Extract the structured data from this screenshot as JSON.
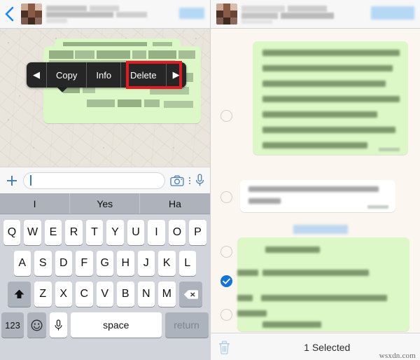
{
  "left_panel": {
    "nav": {
      "back_icon": "back-chevron-icon",
      "avatar_icon": "contact-avatar",
      "contact_name_redacted": "",
      "call_action_redacted": ""
    },
    "context_menu": {
      "prev_label": "◀",
      "items": [
        "Copy",
        "Info",
        "Delete"
      ],
      "next_label": "▶",
      "highlighted_item": "Delete",
      "highlight_color": "#e01b24",
      "background_color": "#262626"
    },
    "input_bar": {
      "attach_label": "+",
      "placeholder": "",
      "value": "",
      "camera_icon": "camera-icon",
      "more_icon": "more-vertical-icon",
      "mic_icon": "microphone-icon"
    },
    "keyboard": {
      "predictions": [
        "I",
        "Yes",
        "Ha"
      ],
      "row1": [
        "Q",
        "W",
        "E",
        "R",
        "T",
        "Y",
        "U",
        "I",
        "O",
        "P"
      ],
      "row2": [
        "A",
        "S",
        "D",
        "F",
        "G",
        "H",
        "J",
        "K",
        "L"
      ],
      "row3": [
        "Z",
        "X",
        "C",
        "V",
        "B",
        "N",
        "M"
      ],
      "shift_icon": "shift-arrow-icon",
      "backspace_icon": "backspace-icon",
      "numbers_label": "123",
      "emoji_icon": "smiley-icon",
      "dictation_icon": "microphone-icon",
      "space_label": "space",
      "return_label": "return"
    }
  },
  "right_panel": {
    "nav": {
      "avatar_icon": "contact-avatar",
      "contact_name_redacted": "",
      "call_action_redacted": ""
    },
    "messages": [
      {
        "id": "msg-1",
        "direction": "outgoing",
        "selected": false,
        "text_redacted": "Hi, all done and dusted here - sat in train back, now so should be in office at 3. Discovery had a guy filming and put on a GoPro so should have some footage to go with article too!",
        "timestamp_redacted": ""
      },
      {
        "id": "msg-2",
        "direction": "incoming",
        "selected": false,
        "text_redacted": "Sounds good! Can't wait to see",
        "timestamp_redacted": ""
      },
      {
        "id": "msg-3",
        "direction": "outgoing",
        "selected": true,
        "text_redacted": "",
        "timestamp_redacted": ""
      },
      {
        "id": "msg-4",
        "direction": "outgoing",
        "selected": false,
        "text_redacted": "",
        "timestamp_redacted": ""
      }
    ],
    "bottom_bar": {
      "trash_icon": "trash-icon",
      "selection_label": "1 Selected",
      "trash_highlight_color": "#e01b24"
    }
  },
  "watermark": {
    "text": "wsxdn.com"
  },
  "colors": {
    "outgoing_bubble": "#dcf8c6",
    "incoming_bubble": "#ffffff",
    "chat_background": "#eae5dc",
    "accent_blue": "#1274d8",
    "highlight_red": "#e01b24",
    "menu_dark": "#262626",
    "keyboard_bg": "#d1d4da"
  }
}
